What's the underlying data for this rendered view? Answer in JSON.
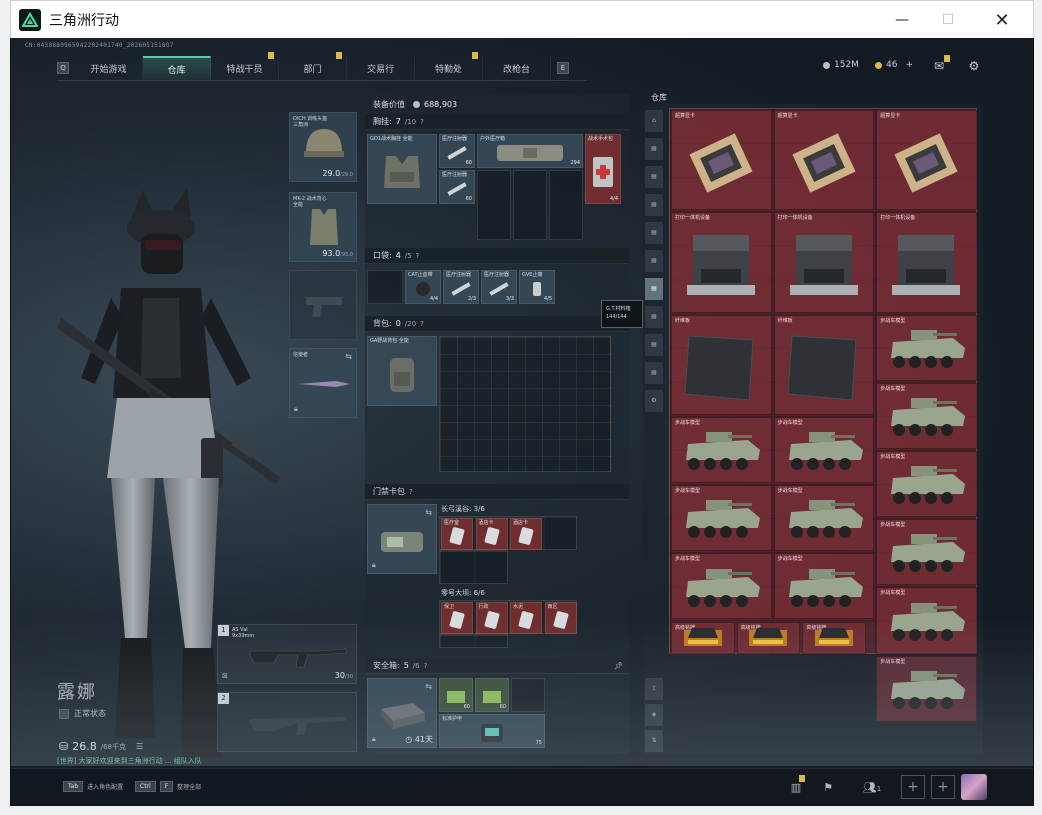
{
  "window": {
    "title": "三角洲行动",
    "min": "—",
    "max": "☐",
    "close": "✕"
  },
  "session_id": "CN:0438880965942202401740_2026051518O7",
  "nav": {
    "left_key": "Q",
    "right_key": "E",
    "tabs": [
      {
        "label": "开始游戏",
        "flag": false,
        "active": false
      },
      {
        "label": "仓库",
        "flag": false,
        "active": true
      },
      {
        "label": "特战干员",
        "flag": true,
        "active": false
      },
      {
        "label": "部门",
        "flag": true,
        "active": false
      },
      {
        "label": "交易行",
        "flag": false,
        "active": false
      },
      {
        "label": "特勤处",
        "flag": true,
        "active": false
      },
      {
        "label": "改枪台",
        "flag": false,
        "active": false
      }
    ]
  },
  "currency": {
    "money": "152M",
    "coins": "46",
    "plus": "+"
  },
  "colors": {
    "accent": "#5ec8a6",
    "storage_bg": "#782830",
    "flag": "#e0b84a"
  },
  "equipment": {
    "helmet": {
      "name": "DICH 训练头盔",
      "sub": "三角洲",
      "value": "29.0",
      "max": "/29.0"
    },
    "armor": {
      "name": "MK-2 战术背心",
      "sub": "全能",
      "value": "93.0",
      "max": "/93.0"
    },
    "melee": {
      "name": "信使者"
    }
  },
  "weapons": [
    {
      "idx": "1",
      "name": "AS Val",
      "sub": "9x39mm",
      "ammo": "30",
      "ammo_max": "/30"
    },
    {
      "idx": "2",
      "name": "",
      "ammo": "",
      "ammo_max": ""
    }
  ],
  "operator": {
    "name": "露娜",
    "sub": "正常状态",
    "weight": "26.8",
    "weight_max": "/68千克",
    "chat": "[世界] 大家好欢迎来到三角洲行动 ... 组队入队"
  },
  "loadout": {
    "value_label": "装备价值",
    "value": "688,903",
    "chest": {
      "label": "胸挂:",
      "count": "7",
      "total": "/10",
      "items": [
        {
          "name": "GO1战术胸挂 全能",
          "count": ""
        },
        {
          "name": "医疗注射器",
          "count": "60"
        },
        {
          "name": "医疗注射器",
          "count": "60"
        },
        {
          "name": "户外医疗箱",
          "count": "294"
        },
        {
          "name": "战术手术包",
          "count": "4/4"
        }
      ]
    },
    "pocket": {
      "label": "口袋:",
      "count": "4",
      "total": "/5",
      "items": [
        {
          "name": "CAT止血带",
          "count": "4/4"
        },
        {
          "name": "医疗注射器",
          "count": "2/3"
        },
        {
          "name": "医疗注射器",
          "count": "3/3"
        },
        {
          "name": "GVE止痛",
          "count": "4/5"
        }
      ]
    },
    "backpack": {
      "label": "背包:",
      "count": "0",
      "total": "/20",
      "item": "GA野战背包 全能"
    },
    "keycard": {
      "label": "门禁卡包",
      "group1": "长弓溪谷: 3/6",
      "group2": "零号大坝: 6/6",
      "k1": [
        "医疗室",
        "酒店卡",
        "酒店卡"
      ],
      "k2": [
        "保卫",
        "行政",
        "水泥",
        "西区"
      ]
    },
    "safebox": {
      "label": "安全箱:",
      "count": "5",
      "total": "/6",
      "days": "41天",
      "items": [
        {
          "name": "弹药",
          "count": "60"
        },
        {
          "name": "弹药",
          "count": "60"
        },
        {
          "name": "标准护甲",
          "count": "75"
        }
      ]
    }
  },
  "tooltip": {
    "name": "G.T.材料箱",
    "count": "144/144"
  },
  "storage": {
    "title": "仓库",
    "items": [
      {
        "name": "超算显卡",
        "type": "gpu"
      },
      {
        "name": "超算显卡",
        "type": "gpu"
      },
      {
        "name": "超算显卡",
        "type": "gpu"
      },
      {
        "name": "打印一体机设备",
        "type": "printer"
      },
      {
        "name": "打印一体机设备",
        "type": "printer"
      },
      {
        "name": "打印一体机设备",
        "type": "printer"
      },
      {
        "name": "纤维板",
        "type": "board"
      },
      {
        "name": "纤维板",
        "type": "board"
      },
      {
        "name": "步战车模型",
        "type": "tank"
      },
      {
        "name": "步战车模型",
        "type": "tank"
      },
      {
        "name": "步战车模型",
        "type": "tank"
      },
      {
        "name": "步战车模型",
        "type": "tank"
      },
      {
        "name": "步战车模型",
        "type": "tank"
      },
      {
        "name": "步战车模型",
        "type": "tank"
      },
      {
        "name": "步战车模型",
        "type": "tank"
      },
      {
        "name": "步战车模型",
        "type": "tank"
      },
      {
        "name": "步战车模型",
        "type": "tank"
      },
      {
        "name": "步战车模型",
        "type": "tank"
      },
      {
        "name": "步战车模型",
        "type": "tank"
      },
      {
        "name": "步战车模型",
        "type": "tank"
      },
      {
        "name": "高级铭牌",
        "type": "badge"
      },
      {
        "name": "高级铭牌",
        "type": "badge"
      },
      {
        "name": "高级铭牌",
        "type": "badge"
      }
    ]
  },
  "bottom": {
    "hint1_key": "Tab",
    "hint1": "进入角色配置",
    "hint2_key": "Ctrl",
    "hint2_key2": "F",
    "hint2": "整理全部",
    "friends": "1",
    "plus": "+"
  }
}
